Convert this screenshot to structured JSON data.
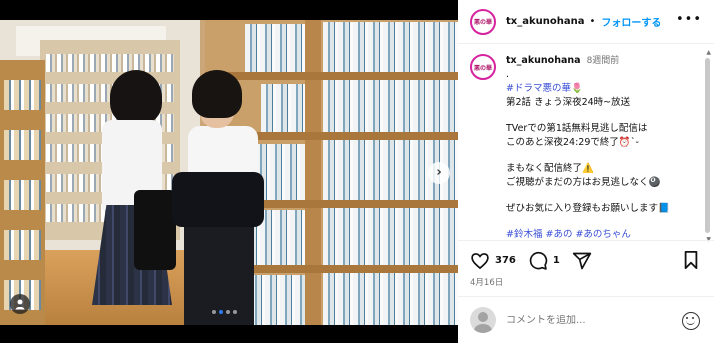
{
  "post": {
    "account": "tx_akunohana",
    "avatar_text": "悪の華",
    "separator": "•",
    "follow_label": "フォローする",
    "more_label": "•••"
  },
  "caption": {
    "username": "tx_akunohana",
    "time_ago": "8週間前",
    "lines": [
      ".",
      "#ドラマ悪の華🌷",
      "第2話 きょう深夜24時~放送",
      "",
      "TVerでの第1話無料見逃し配信は",
      "このあと深夜24:29で終了⏰`-",
      "",
      "まもなく配信終了⚠️",
      "ご視聴がまだの方はお見逃しなく🎱",
      "",
      "ぜひお気に入り登録もお願いします📘",
      "",
      "#鈴木福 #あの #あのちゃん"
    ]
  },
  "actions": {
    "like_count": "376",
    "comment_count": "1",
    "like_icon": "heart-icon",
    "comment_icon": "comment-icon",
    "share_icon": "share-icon",
    "save_icon": "bookmark-icon"
  },
  "date": "4月16日",
  "comment_box": {
    "placeholder": "コメントを追加..."
  },
  "media": {
    "next_icon": "›",
    "user_tag_icon": "person-icon",
    "carousel_dots": 4,
    "carousel_active": 1
  },
  "colors": {
    "link_blue": "#0095f6",
    "hashtag": "#3b4fd6",
    "avatar_ring": "#d6249f"
  }
}
